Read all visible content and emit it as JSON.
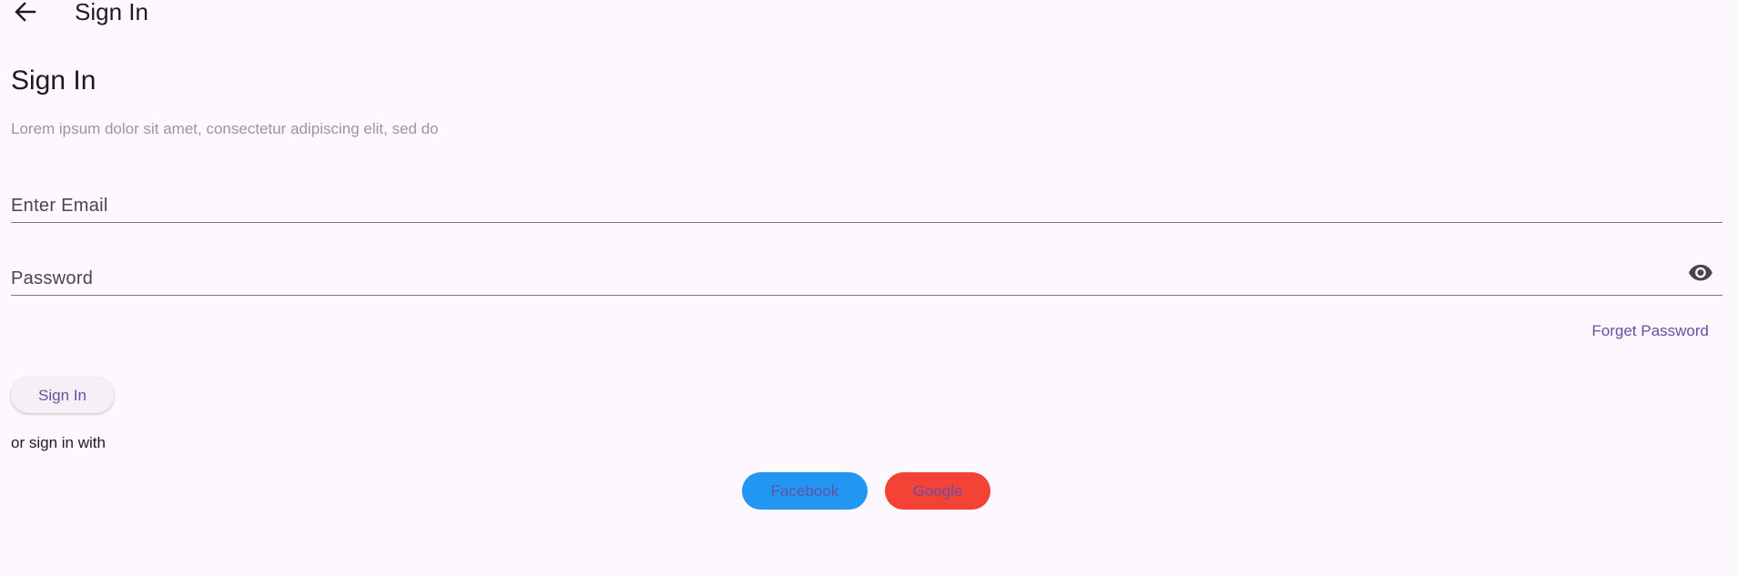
{
  "appbar": {
    "title": "Sign In",
    "back_icon": "arrow-back-icon"
  },
  "main": {
    "heading": "Sign In",
    "subtitle": "Lorem ipsum dolor sit amet, consectetur adipiscing elit, sed do",
    "email": {
      "placeholder": "Enter Email",
      "value": ""
    },
    "password": {
      "placeholder": "Password",
      "value": "",
      "visibility_icon": "eye-icon"
    },
    "forget_password": "Forget Password",
    "signin_button": "Sign In",
    "or_text": "or sign in with",
    "social": {
      "facebook": "Facebook",
      "google": "Google"
    }
  },
  "colors": {
    "background": "#fdf7fe",
    "accent": "#6750a4",
    "facebook": "#2196f3",
    "google": "#f44336",
    "muted_text": "#9a979c"
  }
}
